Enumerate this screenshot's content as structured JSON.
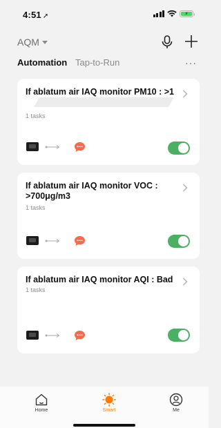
{
  "status_bar": {
    "time": "4:51"
  },
  "header": {
    "home_name": "AQM"
  },
  "tabs": {
    "automation": "Automation",
    "tap_to_run": "Tap-to-Run",
    "more": "···"
  },
  "cards": [
    {
      "title": "If ablatum air IAQ monitor  PM10 : >1",
      "subtitle": "1 tasks",
      "enabled": true
    },
    {
      "title": "If ablatum air IAQ monitor  VOC : >700μg/m3",
      "subtitle": "1 tasks",
      "enabled": true
    },
    {
      "title": "If ablatum air IAQ monitor  AQI : Bad",
      "subtitle": "1 tasks",
      "enabled": true
    }
  ],
  "nav": [
    {
      "label": "Home",
      "icon": "home-icon"
    },
    {
      "label": "Smart",
      "icon": "smart-sun-icon",
      "active": true
    },
    {
      "label": "Me",
      "icon": "profile-icon"
    }
  ],
  "colors": {
    "accent": "#ff7a00",
    "toggle_on": "#4cb064",
    "message_icon": "#f36b4c"
  }
}
